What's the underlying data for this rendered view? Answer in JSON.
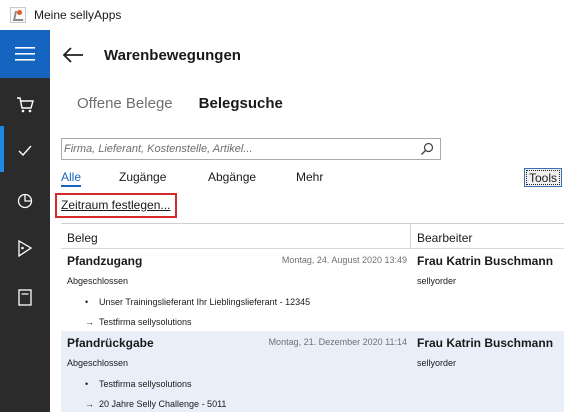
{
  "window": {
    "title": "Meine sellyApps"
  },
  "rail": {
    "items": [
      {
        "icon": "hamburger-menu-icon"
      },
      {
        "icon": "cart-icon"
      },
      {
        "icon": "checkmark-icon"
      },
      {
        "icon": "pie-chart-icon"
      },
      {
        "icon": "tag-icon"
      },
      {
        "icon": "book-icon"
      }
    ]
  },
  "header": {
    "title": "Warenbewegungen",
    "back_icon": "back-arrow-icon"
  },
  "pivot": {
    "tabs": [
      {
        "label": "Offene Belege",
        "active": false
      },
      {
        "label": "Belegsuche",
        "active": true
      }
    ]
  },
  "search": {
    "placeholder": "Firma, Lieferant, Kostenstelle, Artikel...",
    "value": "",
    "icon": "search-icon"
  },
  "filters": {
    "tabs": [
      {
        "label": "Alle",
        "active": true
      },
      {
        "label": "Zugänge",
        "active": false
      },
      {
        "label": "Abgänge",
        "active": false
      },
      {
        "label": "Mehr",
        "active": false
      }
    ],
    "tools_label": "Tools"
  },
  "zeitraum": {
    "label": "Zeitraum festlegen..."
  },
  "colors": {
    "accent": "#1565c0",
    "rail": "#2b2b2b",
    "highlight": "#d42a2a",
    "selected_row": "#e8eff9"
  },
  "grid": {
    "columns": [
      "Beleg",
      "Bearbeiter"
    ],
    "rows": [
      {
        "title": "Pfandzugang",
        "date": "Montag, 24. August 2020 13:49",
        "status": "Abgeschlossen",
        "person": "Frau Katrin Buschmann",
        "user": "sellyorder",
        "lines": [
          {
            "marker": "•",
            "text": "Unser Trainingslieferant Ihr Lieblingslieferant - 12345"
          },
          {
            "marker": "→",
            "text": "Testfirma sellysolutions"
          }
        ],
        "selected": false
      },
      {
        "title": "Pfandrückgabe",
        "date": "Montag, 21. Dezember 2020 11:14",
        "status": "Abgeschlossen",
        "person": "Frau Katrin Buschmann",
        "user": "sellyorder",
        "lines": [
          {
            "marker": "•",
            "text": "Testfirma sellysolutions"
          },
          {
            "marker": "→",
            "text": "20 Jahre Selly Challenge - 5011"
          }
        ],
        "selected": true
      }
    ]
  }
}
